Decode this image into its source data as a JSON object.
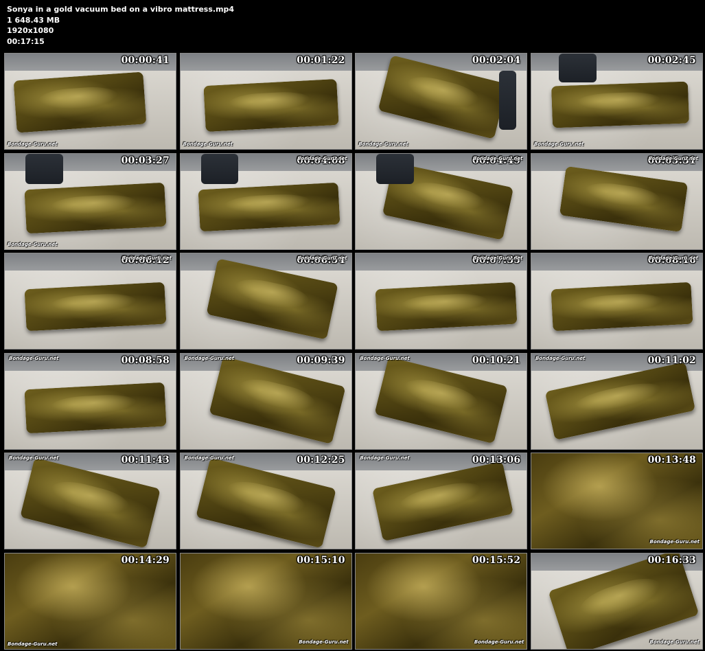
{
  "header": {
    "filename": "Sonya in a gold vacuum bed on a vibro mattress.mp4",
    "filesize": "1 648.43 MB",
    "resolution": "1920x1080",
    "duration": "00:17:15"
  },
  "watermark_text": "Bondage-Guru.net",
  "thumbnails": [
    {
      "time": "00:00:41",
      "scene": "bed",
      "wm": "bl"
    },
    {
      "time": "00:01:22",
      "scene": "bed",
      "wm": "bl"
    },
    {
      "time": "00:02:04",
      "scene": "bed-person",
      "wm": "bl"
    },
    {
      "time": "00:02:45",
      "scene": "bed-person",
      "wm": "bl"
    },
    {
      "time": "00:03:27",
      "scene": "bed-person",
      "wm": "bl"
    },
    {
      "time": "00:04:08",
      "scene": "bed-person",
      "wm": "tr"
    },
    {
      "time": "00:04:49",
      "scene": "bed-person",
      "wm": "tr"
    },
    {
      "time": "00:05:31",
      "scene": "bed",
      "wm": "tr"
    },
    {
      "time": "00:06:12",
      "scene": "bed",
      "wm": "tr"
    },
    {
      "time": "00:06:54",
      "scene": "bed",
      "wm": "tr"
    },
    {
      "time": "00:07:35",
      "scene": "bed",
      "wm": "tr"
    },
    {
      "time": "00:08:16",
      "scene": "bed",
      "wm": "tr"
    },
    {
      "time": "00:08:58",
      "scene": "bed",
      "wm": "tl"
    },
    {
      "time": "00:09:39",
      "scene": "bed",
      "wm": "tl"
    },
    {
      "time": "00:10:21",
      "scene": "bed",
      "wm": "tl"
    },
    {
      "time": "00:11:02",
      "scene": "bed",
      "wm": "tl"
    },
    {
      "time": "00:11:43",
      "scene": "bed",
      "wm": "tl"
    },
    {
      "time": "00:12:25",
      "scene": "bed",
      "wm": "tl"
    },
    {
      "time": "00:13:06",
      "scene": "bed",
      "wm": "tl"
    },
    {
      "time": "00:13:48",
      "scene": "closeup",
      "wm": "br"
    },
    {
      "time": "00:14:29",
      "scene": "closeup",
      "wm": "bl"
    },
    {
      "time": "00:15:10",
      "scene": "closeup",
      "wm": "br"
    },
    {
      "time": "00:15:52",
      "scene": "closeup",
      "wm": "br"
    },
    {
      "time": "00:16:33",
      "scene": "bed",
      "wm": "br"
    }
  ]
}
